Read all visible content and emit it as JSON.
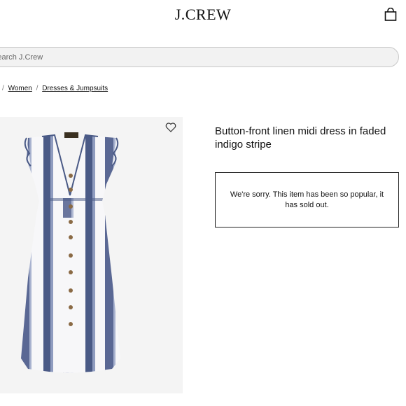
{
  "header": {
    "logo": "J.CREW",
    "bag_icon": "shopping-bag-icon"
  },
  "search": {
    "placeholder": "Search J.Crew",
    "icon": "none"
  },
  "breadcrumb": {
    "items": [
      "Women",
      "Dresses & Jumpsuits"
    ],
    "separator": "/"
  },
  "product": {
    "title": "Button-front linen midi dress in faded indigo stripe",
    "wishlist_icon": "heart-icon",
    "sold_out_message": "We're sorry. This item has been so popular, it has sold out.",
    "image_colors": {
      "stripe": "#4a5a86",
      "light_stripe": "#8f9cbf",
      "base": "#f7f7f9",
      "button": "#8a6a45"
    }
  }
}
